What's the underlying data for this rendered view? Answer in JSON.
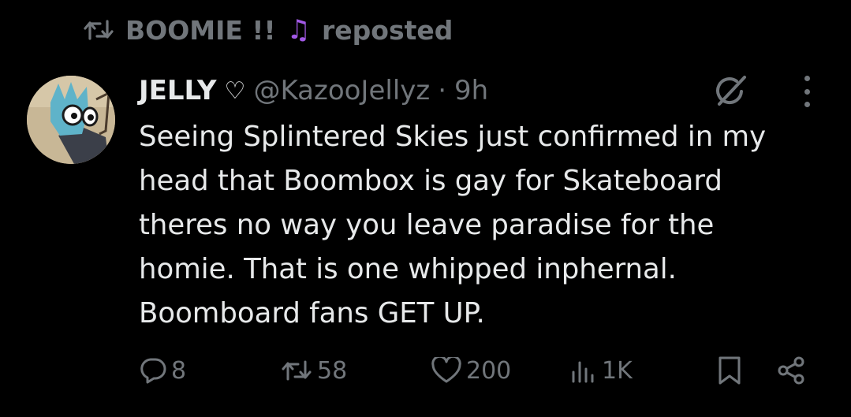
{
  "repost": {
    "user": "BOOMIE !!",
    "emoji": "♫",
    "label": "reposted"
  },
  "post": {
    "name": "JELLY",
    "name_symbol": "♡",
    "handle": "@KazooJellyz",
    "separator": "·",
    "time": "9h",
    "text": "Seeing Splintered Skies just confirmed in my\nhead that Boombox is gay for Skateboard\ntheres no way you leave paradise for the\nhomie. That is one whipped inphernal.\nBoomboard fans GET UP."
  },
  "actions": {
    "replies": "8",
    "reposts": "58",
    "likes": "200",
    "views": "1K"
  },
  "colors": {
    "background": "#000000",
    "text": "#e7e9ea",
    "muted": "#71767b",
    "note": "#a259e6"
  }
}
